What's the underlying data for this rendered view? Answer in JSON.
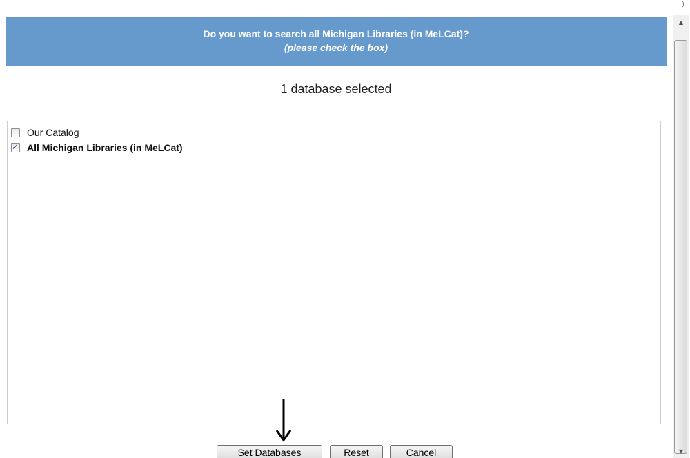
{
  "header": {
    "title": "Do you want to search all Michigan Libraries (in MeLCat)?",
    "subtitle": "(please check the box)",
    "background_color": "#6699cc"
  },
  "selection_status": "1 database selected",
  "databases": [
    {
      "label": "Our Catalog",
      "checked": false,
      "bold": false
    },
    {
      "label": "All Michigan Libraries (in MeLCat)",
      "checked": true,
      "bold": true
    }
  ],
  "buttons": {
    "set_databases": "Set Databases",
    "reset": "Reset",
    "cancel": "Cancel"
  },
  "checkmark_glyph": "✓",
  "icons": {
    "annotation": "down-arrow-icon",
    "scroll_up": "scroll-up-arrow-icon",
    "scroll_down": "scroll-down-arrow-icon"
  }
}
